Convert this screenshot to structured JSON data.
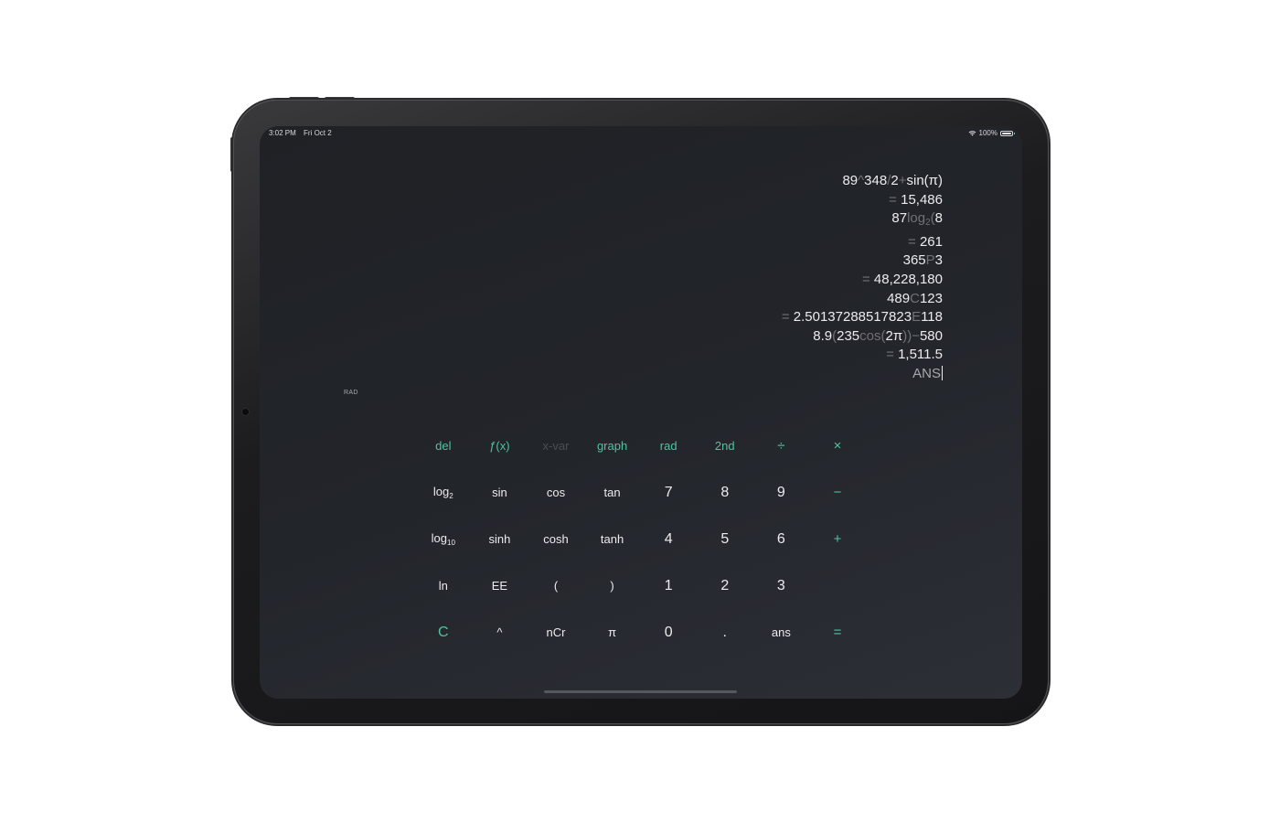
{
  "status_bar": {
    "time": "3:02 PM",
    "date": "Fri Oct 2",
    "battery": "100%",
    "wifi_icon": "wifi-icon",
    "battery_icon": "battery-icon"
  },
  "history": [
    {
      "parts": [
        [
          "89",
          "n"
        ],
        [
          "^",
          "d"
        ],
        [
          "348",
          "n"
        ],
        [
          "/",
          "d"
        ],
        [
          "2",
          "n"
        ],
        [
          "+",
          "d"
        ],
        [
          "sin(π)",
          "n"
        ]
      ]
    },
    {
      "parts": [
        [
          "= ",
          "d"
        ],
        [
          "15,486",
          "n"
        ]
      ]
    },
    {
      "parts": [
        [
          "87",
          "n"
        ],
        [
          "log",
          "d"
        ],
        [
          "2",
          "sub"
        ],
        [
          "(",
          "d"
        ],
        [
          "8",
          "n"
        ]
      ]
    },
    {
      "parts": [
        [
          "= ",
          "d"
        ],
        [
          "261",
          "n"
        ]
      ]
    },
    {
      "parts": [
        [
          "365",
          "n"
        ],
        [
          "P",
          "d"
        ],
        [
          "3",
          "n"
        ]
      ]
    },
    {
      "parts": [
        [
          "= ",
          "d"
        ],
        [
          "48,228,180",
          "n"
        ]
      ]
    },
    {
      "parts": [
        [
          "489",
          "n"
        ],
        [
          "C",
          "d"
        ],
        [
          "123",
          "n"
        ]
      ]
    },
    {
      "parts": [
        [
          "= ",
          "d"
        ],
        [
          "2.50137288517823",
          "n"
        ],
        [
          "E",
          "d"
        ],
        [
          "118",
          "n"
        ]
      ]
    },
    {
      "parts": [
        [
          "8.9",
          "n"
        ],
        [
          "(",
          "d"
        ],
        [
          "235",
          "n"
        ],
        [
          "cos",
          "d"
        ],
        [
          "(",
          "d"
        ],
        [
          "2π",
          "n"
        ],
        [
          "))",
          "d"
        ],
        [
          "−",
          "d"
        ],
        [
          "580",
          "n"
        ]
      ]
    },
    {
      "parts": [
        [
          "= ",
          "d"
        ],
        [
          "1,511.5",
          "n"
        ]
      ]
    }
  ],
  "current_input": "ANS",
  "mode_label": "RAD",
  "keypad": {
    "rows": [
      [
        {
          "label": "del",
          "style": "accent"
        },
        {
          "label": "ƒ(x)",
          "style": "accent"
        },
        {
          "label": "x-var",
          "style": "dim"
        },
        {
          "label": "graph",
          "style": "accent"
        },
        {
          "label": "rad",
          "style": "accent"
        },
        {
          "label": "2nd",
          "style": "accent"
        },
        {
          "label": "÷",
          "style": "accent op"
        },
        {
          "label": "×",
          "style": "accent op"
        }
      ],
      [
        {
          "label": "log",
          "sub": "2",
          "style": ""
        },
        {
          "label": "sin",
          "style": ""
        },
        {
          "label": "cos",
          "style": ""
        },
        {
          "label": "tan",
          "style": ""
        },
        {
          "label": "7",
          "style": "num"
        },
        {
          "label": "8",
          "style": "num"
        },
        {
          "label": "9",
          "style": "num"
        },
        {
          "label": "−",
          "style": "accent op"
        }
      ],
      [
        {
          "label": "log",
          "sub": "10",
          "style": ""
        },
        {
          "label": "sinh",
          "style": ""
        },
        {
          "label": "cosh",
          "style": ""
        },
        {
          "label": "tanh",
          "style": ""
        },
        {
          "label": "4",
          "style": "num"
        },
        {
          "label": "5",
          "style": "num"
        },
        {
          "label": "6",
          "style": "num"
        },
        {
          "label": "+",
          "style": "accent op"
        }
      ],
      [
        {
          "label": "ln",
          "style": ""
        },
        {
          "label": "EE",
          "style": ""
        },
        {
          "label": "(",
          "style": ""
        },
        {
          "label": ")",
          "style": ""
        },
        {
          "label": "1",
          "style": "num"
        },
        {
          "label": "2",
          "style": "num"
        },
        {
          "label": "3",
          "style": "num"
        },
        {
          "label": "",
          "style": ""
        }
      ],
      [
        {
          "label": "C",
          "style": "accent big"
        },
        {
          "label": "^",
          "style": ""
        },
        {
          "label": "nCr",
          "style": ""
        },
        {
          "label": "π",
          "style": ""
        },
        {
          "label": "0",
          "style": "num"
        },
        {
          "label": ".",
          "style": "num"
        },
        {
          "label": "ans",
          "style": ""
        },
        {
          "label": "=",
          "style": "accent op"
        }
      ]
    ]
  },
  "colors": {
    "accent": "#4fc4a0",
    "background": "#22252a",
    "text": "#ececef",
    "dim_text": "#6f7177"
  }
}
